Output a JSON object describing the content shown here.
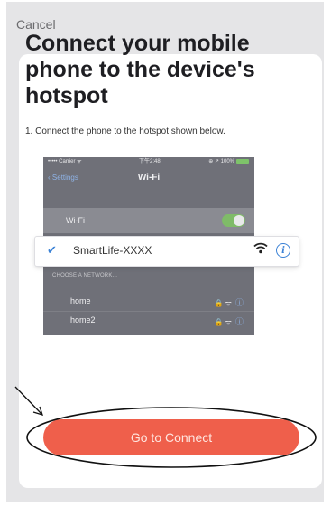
{
  "header": {
    "cancel_label": "Cancel"
  },
  "main": {
    "title": "Connect your mobile phone to the device's hotspot",
    "instruction": "1. Connect the phone to the hotspot shown below."
  },
  "phone_screenshot": {
    "carrier": "••••• Carrier ᯤ",
    "time": "下午2:48",
    "battery": "⊕ ↗ 100%",
    "back_label": "Settings",
    "nav_title": "Wi-Fi",
    "wifi_label": "Wi-Fi",
    "wifi_enabled": true,
    "selected_network": "SmartLife-XXXX",
    "section_header": "CHOOSE A NETWORK...",
    "networks": [
      {
        "name": "home"
      },
      {
        "name": "home2"
      }
    ]
  },
  "actions": {
    "connect_label": "Go to Connect"
  },
  "colors": {
    "accent_button": "#ef5f4b",
    "link_blue": "#3b82d6",
    "toggle_green": "#7fbb68",
    "backdrop": "#e5e5e7"
  },
  "icons": [
    "checkmark-icon",
    "wifi-icon",
    "info-icon",
    "lock-icon",
    "chevron-left-icon"
  ]
}
